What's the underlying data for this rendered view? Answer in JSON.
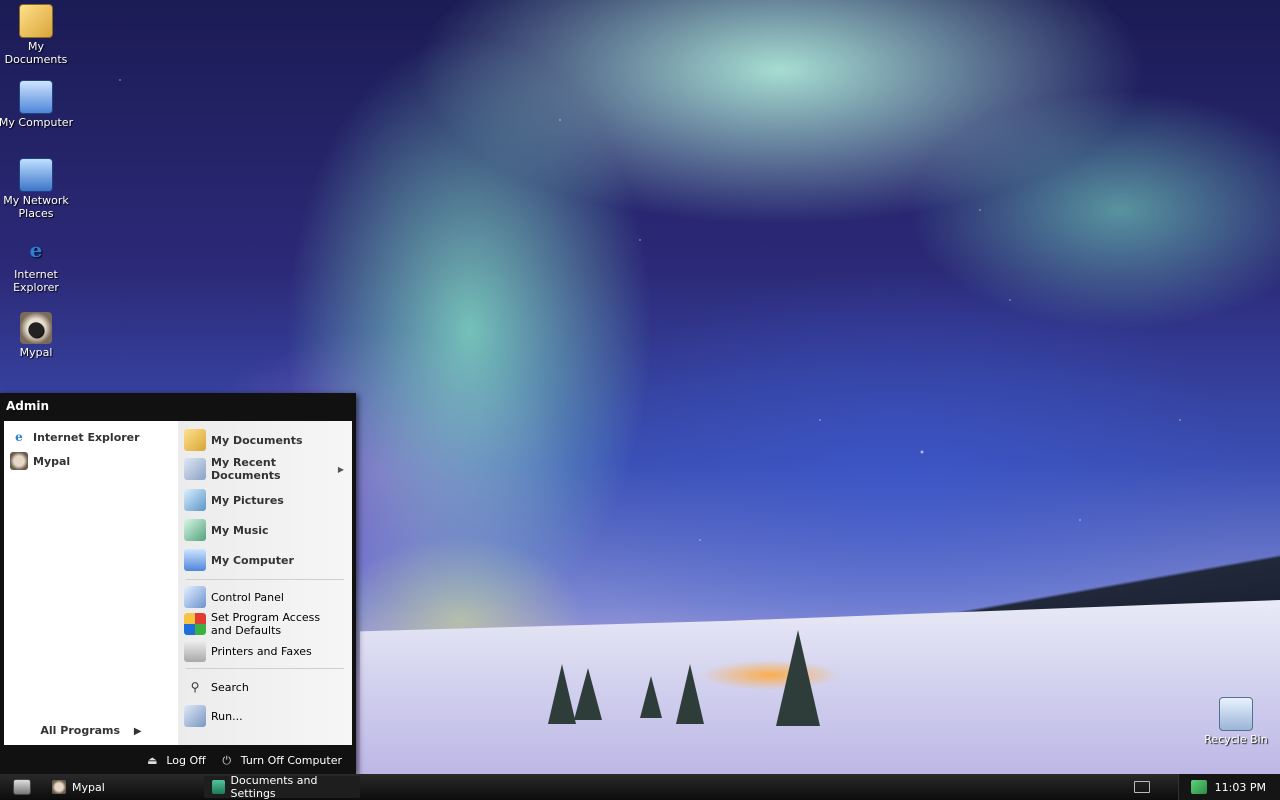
{
  "desktop_icons": [
    {
      "label": "My Documents",
      "icon": "folder-icon"
    },
    {
      "label": "My Computer",
      "icon": "computer-icon"
    },
    {
      "label": "My Network Places",
      "icon": "network-icon"
    },
    {
      "label": "Internet Explorer",
      "icon": "ie-icon"
    },
    {
      "label": "Mypal",
      "icon": "raccoon-icon"
    }
  ],
  "recycle_bin": {
    "label": "Recycle Bin",
    "icon": "recycle-bin-icon"
  },
  "start_menu": {
    "user": "Admin",
    "pinned": [
      {
        "label": "Internet Explorer",
        "icon": "ie-icon"
      },
      {
        "label": "Mypal",
        "icon": "raccoon-icon"
      }
    ],
    "all_programs": "All Programs",
    "places": [
      {
        "label": "My Documents",
        "icon": "folder-icon"
      },
      {
        "label": "My Recent Documents",
        "icon": "recent-documents-icon"
      },
      {
        "label": "My Pictures",
        "icon": "pictures-icon"
      },
      {
        "label": "My Music",
        "icon": "music-icon"
      },
      {
        "label": "My Computer",
        "icon": "computer-icon"
      }
    ],
    "settings": [
      {
        "label": "Control Panel",
        "icon": "control-panel-icon"
      },
      {
        "label": "Set Program Access and Defaults",
        "icon": "program-access-icon"
      },
      {
        "label": "Printers and Faxes",
        "icon": "printer-icon"
      }
    ],
    "tools": [
      {
        "label": "Search",
        "icon": "search-icon"
      },
      {
        "label": "Run...",
        "icon": "run-icon"
      }
    ],
    "log_off": "Log Off",
    "turn_off": "Turn Off Computer"
  },
  "taskbar": {
    "tasks": [
      {
        "label": "Mypal",
        "icon": "raccoon-icon"
      },
      {
        "label": "Documents and Settings",
        "icon": "folder-icon"
      }
    ],
    "clock": "11:03 PM"
  },
  "colors": {
    "start_menu_bg": "#111111",
    "taskbar_bg": "#0c0c0c"
  }
}
